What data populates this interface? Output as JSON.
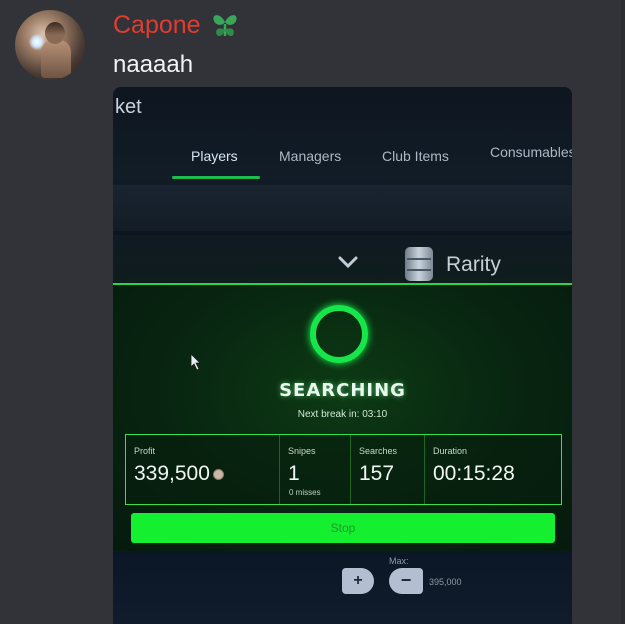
{
  "message": {
    "username": "Capone",
    "role_icon": "green-heart-plant-icon",
    "text": "naaaah"
  },
  "colors": {
    "background": "#313338",
    "username": "#e03d2f",
    "accent_green": "#14f02f"
  },
  "photo": {
    "app_title": "ket",
    "tabs": [
      {
        "label": "Players",
        "active": true
      },
      {
        "label": "Managers",
        "active": false
      },
      {
        "label": "Club Items",
        "active": false
      },
      {
        "label": "Consumables",
        "active": false
      }
    ],
    "filter": {
      "dropdown_icon": "chevron-down-icon",
      "rarity_label": "Rarity"
    },
    "status": {
      "title": "SEARCHING",
      "next_break": "Next break in: 03:10"
    },
    "stats": {
      "profit_label": "Profit",
      "profit_value": "339,500",
      "snipes_label": "Snipes",
      "snipes_value": "1",
      "snipes_sub": "0 misses",
      "searches_label": "Searches",
      "searches_value": "157",
      "duration_label": "Duration",
      "duration_value": "00:15:28"
    },
    "stop_label": "Stop",
    "price": {
      "max_label": "Max:",
      "plus": "+",
      "minus": "−",
      "max_value": "395,000"
    }
  }
}
